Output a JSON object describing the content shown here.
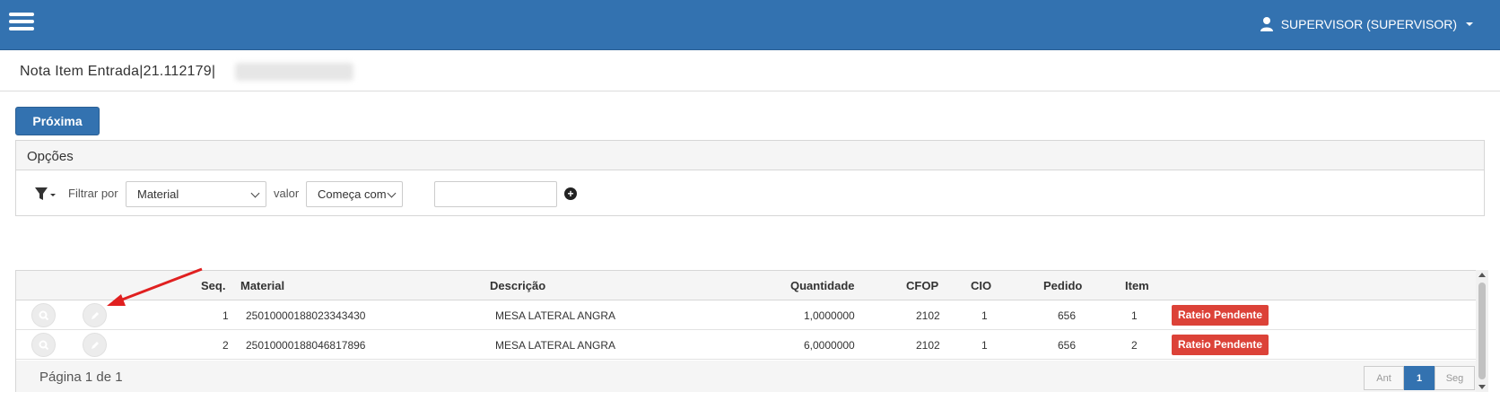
{
  "header": {
    "menu_icon": "hamburger-menu-icon",
    "user_icon": "user-icon",
    "user_label": "SUPERVISOR (SUPERVISOR)",
    "user_caret_icon": "caret-down-icon",
    "brand_color": "#3372b0"
  },
  "page": {
    "title": "Nota Item Entrada|21.112179|"
  },
  "actions": {
    "next_label": "Próxima"
  },
  "options": {
    "heading": "Opções",
    "filter_icon": "filter-icon",
    "filter_by_label": "Filtrar por",
    "field_select_value": "Material",
    "value_label": "valor",
    "operator_select_value": "Começa com",
    "value_input": "",
    "add_filter_icon": "plus-circle-icon"
  },
  "table": {
    "columns": {
      "seq": "Seq.",
      "material": "Material",
      "descricao": "Descrição",
      "quantidade": "Quantidade",
      "cfop": "CFOP",
      "cio": "CIO",
      "pedido": "Pedido",
      "item": "Item"
    },
    "rows": [
      {
        "seq": "1",
        "material": "25010000188023343430",
        "descricao": "MESA LATERAL ANGRA",
        "quantidade": "1,0000000",
        "cfop": "2102",
        "cio": "1",
        "pedido": "656",
        "item": "1",
        "status": "Rateio Pendente"
      },
      {
        "seq": "2",
        "material": "25010000188046817896",
        "descricao": "MESA LATERAL ANGRA",
        "quantidade": "6,0000000",
        "cfop": "2102",
        "cio": "1",
        "pedido": "656",
        "item": "2",
        "status": "Rateio Pendente"
      }
    ],
    "row_icons": [
      "search-icon",
      "pencil-icon"
    ],
    "status_color": "#dc4238"
  },
  "pagination": {
    "info": "Página 1 de 1",
    "prev_label": "Ant",
    "current_page": "1",
    "next_label": "Seg"
  }
}
